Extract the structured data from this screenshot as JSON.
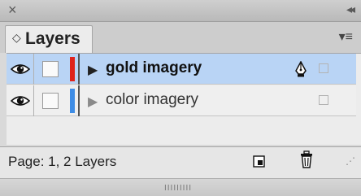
{
  "titlebar": {
    "close_glyph": "×",
    "collapse_glyph": "◂◂"
  },
  "tab": {
    "arrows": "◇",
    "label": "Layers"
  },
  "panel_menu": {
    "glyph": "▾≡"
  },
  "layers": [
    {
      "name": "gold imagery",
      "color": "#e0231b",
      "selected": true,
      "expanded_glyph": "▶"
    },
    {
      "name": "color imagery",
      "color": "#3e8de6",
      "selected": false,
      "expanded_glyph": "▶"
    }
  ],
  "footer": {
    "status": "Page: 1, 2 Layers",
    "grip_glyph": "⋰"
  },
  "bottom": {
    "handle_glyph": "IIIIIIIII"
  },
  "colors": {
    "selected_row": "#b9d4f5",
    "panel_bg": "#d9d9d9"
  }
}
